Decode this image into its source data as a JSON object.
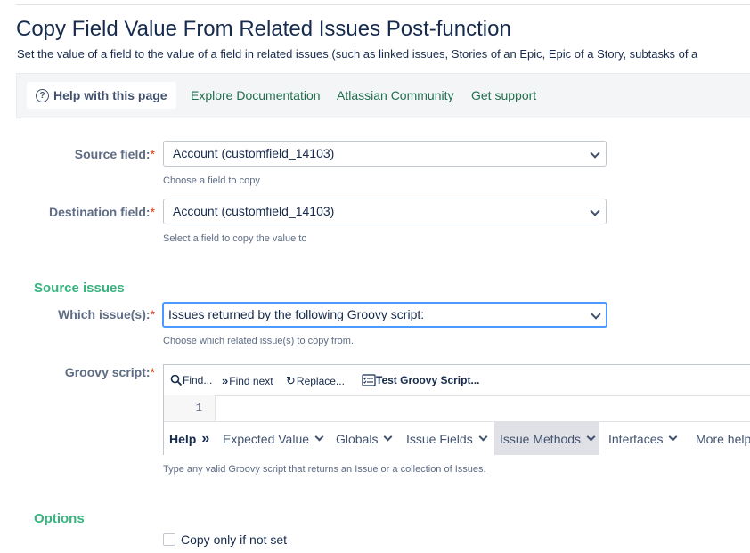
{
  "page": {
    "title": "Copy Field Value From Related Issues Post-function",
    "subtitle": "Set the value of a field to the value of a field in related issues (such as linked issues, Stories of an Epic, Epic of a Story, subtasks of a"
  },
  "helpbar": {
    "active_tab": "Help with this page",
    "links": [
      "Explore Documentation",
      "Atlassian Community",
      "Get support"
    ]
  },
  "form": {
    "source_field": {
      "label": "Source field:",
      "required_mark": "*",
      "value": "Account (customfield_14103)",
      "hint": "Choose a field to copy"
    },
    "destination_field": {
      "label": "Destination field:",
      "required_mark": "*",
      "value": "Account (customfield_14103)",
      "hint": "Select a field to copy the value to"
    },
    "source_issues_heading": "Source issues",
    "which_issues": {
      "label": "Which issue(s):",
      "required_mark": "*",
      "value": "Issues returned by the following Groovy script:",
      "hint": "Choose which related issue(s) to copy from."
    },
    "groovy_script": {
      "label": "Groovy script:",
      "required_mark": "*",
      "toolbar": {
        "find": "Find...",
        "find_next": "Find next",
        "replace": "Replace...",
        "test": "Test Groovy Script..."
      },
      "line_number": "1",
      "footer": {
        "help": "Help",
        "help_arrows": "»",
        "menus": [
          "Expected Value",
          "Globals",
          "Issue Fields",
          "Issue Methods",
          "Interfaces",
          "More help"
        ]
      },
      "hint": "Type any valid Groovy script that returns an Issue or a collection of Issues."
    },
    "options_heading": "Options",
    "copy_only_if_not_set": {
      "label": "Copy only if not set",
      "checked": false
    }
  },
  "colors": {
    "accent_green": "#36b37e",
    "link_green": "#216e4e",
    "required": "#de350b",
    "focus": "#4c9aff"
  }
}
